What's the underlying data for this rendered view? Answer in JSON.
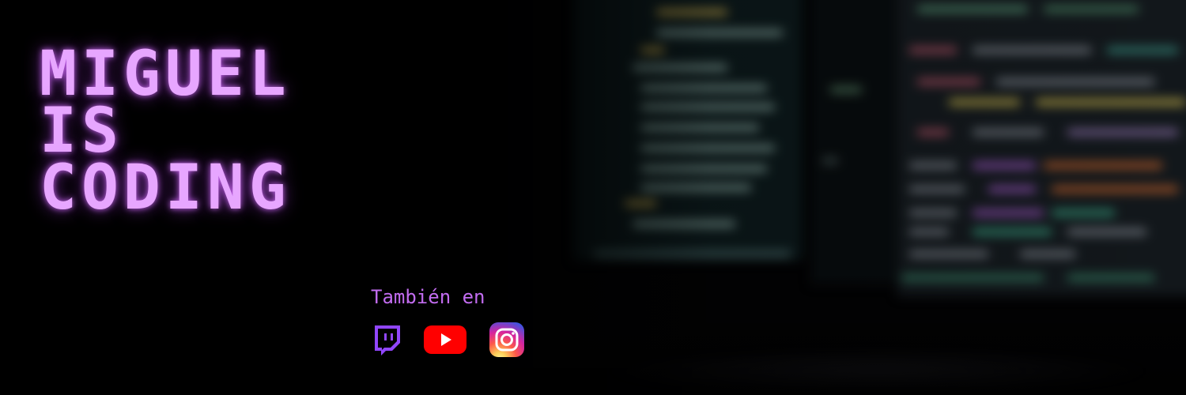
{
  "banner": {
    "title_lines": [
      "Miguel",
      "is",
      "coding"
    ],
    "also_label": "También en",
    "accent_color": "#e7a6ff",
    "label_color": "#c26cf0"
  },
  "social": [
    {
      "icon": "twitch-icon",
      "color": "#9146ff"
    },
    {
      "icon": "youtube-icon",
      "color": "#ff0000"
    },
    {
      "icon": "instagram-icon",
      "color": "#d6249f"
    }
  ]
}
